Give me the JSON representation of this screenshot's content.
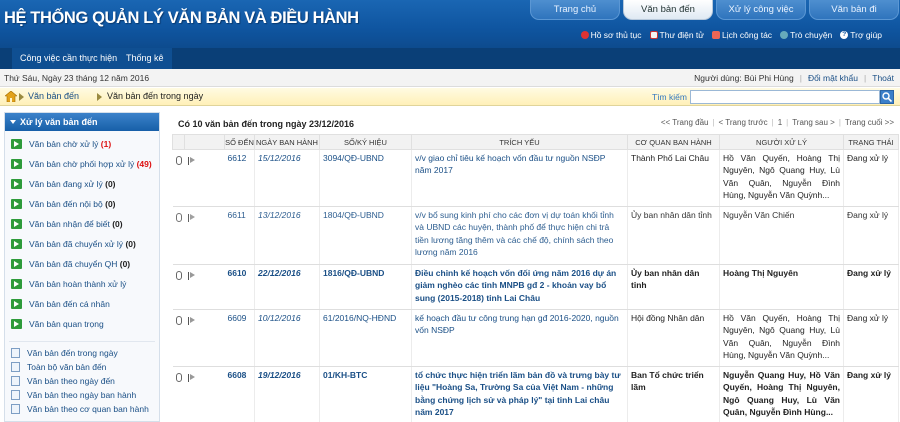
{
  "app": {
    "title": "HỆ THỐNG QUẢN LÝ VĂN BẢN VÀ ĐIỀU HÀNH"
  },
  "main_tabs": [
    {
      "label": "Trang chủ",
      "active": false
    },
    {
      "label": "Văn bản đến",
      "active": true
    },
    {
      "label": "Xử lý công việc",
      "active": false
    },
    {
      "label": "Văn bản đi",
      "active": false
    }
  ],
  "top_links": [
    {
      "label": "Hồ sơ thủ tục",
      "icon": "folder-icon"
    },
    {
      "label": "Thư điện tử",
      "icon": "mail-icon"
    },
    {
      "label": "Lịch công tác",
      "icon": "calendar-icon"
    },
    {
      "label": "Trò chuyện",
      "icon": "chat-icon"
    },
    {
      "label": "Trợ giúp",
      "icon": "help-icon"
    }
  ],
  "subnav": {
    "item1": "Công việc cần thực hiện",
    "item2": "Thống kê"
  },
  "infobar": {
    "date": "Thứ Sáu, Ngày 23 tháng 12 năm 2016",
    "user": "Người dùng: Bùi Phi Hùng",
    "change_password": "Đổi mật khẩu",
    "logout": "Thoát"
  },
  "breadcrumb": {
    "level1": "Văn bản đến",
    "level2": "Văn bản đến trong ngày"
  },
  "search": {
    "label": "Tìm kiếm",
    "value": "",
    "placeholder": ""
  },
  "sidebar": {
    "heading": "Xử lý văn bản đến",
    "items": [
      {
        "label": "Văn bản chờ xử lý",
        "count": "(1)",
        "red": true
      },
      {
        "label": "Văn bản chờ phối hợp xử lý",
        "count": "(49)",
        "red": true
      },
      {
        "label": "Văn bản đang xử lý",
        "count": "(0)",
        "red": false
      },
      {
        "label": "Văn bản đến nội bộ",
        "count": "(0)",
        "red": false
      },
      {
        "label": "Văn bản nhận để biết",
        "count": "(0)",
        "red": false
      },
      {
        "label": "Văn bản đã chuyển xử lý",
        "count": "(0)",
        "red": false
      },
      {
        "label": "Văn bản đã chuyển QH",
        "count": "(0)",
        "red": false
      },
      {
        "label": "Văn bản hoàn thành xử lý",
        "count": "",
        "red": false
      },
      {
        "label": "Văn bản đến cá nhân",
        "count": "",
        "red": false
      },
      {
        "label": "Văn bản quan trọng",
        "count": "",
        "red": false
      }
    ],
    "links": [
      "Văn bản đến trong ngày",
      "Toàn bộ văn bản đến",
      "Văn bản theo ngày đến",
      "Văn bản theo ngày ban hành",
      "Văn bản theo cơ quan ban hành"
    ]
  },
  "main": {
    "title": "Có 10 văn bản đến trong ngày 23/12/2016",
    "pager": {
      "first": "<< Trang đầu",
      "prev": "< Trang trước",
      "page": "1",
      "next": "Trang sau >",
      "last": "Trang cuối >>"
    },
    "columns": {
      "number": "SỐ ĐẾN",
      "issue_date": "NGÀY BAN HÀNH",
      "symbol": "SỐ/KÝ HIỆU",
      "summary": "TRÍCH YẾU",
      "org": "CƠ QUAN BAN HÀNH",
      "processor": "NGƯỜI XỬ LÝ",
      "status": "TRẠNG THÁI"
    },
    "rows": [
      {
        "number": "6612",
        "issue_date": "15/12/2016",
        "symbol": "3094/QĐ-UBND",
        "summary": "v/v giao chỉ tiêu kế hoạch vốn đầu tư nguồn NSĐP năm 2017",
        "org": "Thành Phố Lai Châu",
        "processor": "Hồ Văn Quyến, Hoàng Thị Nguyên, Ngô Quang Huy, Lù Văn Quân, Nguyễn Đình Hùng, Nguyễn Văn Quỳnh...",
        "status": "Đang xử lý",
        "bold": false
      },
      {
        "number": "6611",
        "issue_date": "13/12/2016",
        "symbol": "1804/QĐ-UBND",
        "summary": "v/v bổ sung kinh phí cho các đơn vị dự toán khối tỉnh và UBND các huyện, thành phố để thực hiện chi trả tiền lương tăng thêm và các chế độ, chính sách theo lương năm 2016",
        "org": "Ủy ban nhân dân tỉnh",
        "processor": "Nguyễn Văn Chiến",
        "status": "Đang xử lý",
        "bold": false
      },
      {
        "number": "6610",
        "issue_date": "22/12/2016",
        "symbol": "1816/QĐ-UBND",
        "summary": "Điều chỉnh kế hoạch vốn đối ứng năm 2016 dự án giảm nghèo các tỉnh MNPB gđ 2 - khoản vay bổ sung (2015-2018) tỉnh Lai Châu",
        "org": "Ủy ban nhân dân tỉnh",
        "processor": "Hoàng Thị Nguyên",
        "status": "Đang xử lý",
        "bold": true
      },
      {
        "number": "6609",
        "issue_date": "10/12/2016",
        "symbol": "61/2016/NQ-HĐND",
        "summary": "kế hoạch đầu tư công trung hạn gđ 2016-2020, nguồn vốn NSĐP",
        "org": "Hội đồng Nhân dân",
        "processor": "Hồ Văn Quyến, Hoàng Thị Nguyên, Ngô Quang Huy, Lù Văn Quân, Nguyễn Đình Hùng, Nguyễn Văn Quỳnh...",
        "status": "Đang xử lý",
        "bold": false
      },
      {
        "number": "6608",
        "issue_date": "19/12/2016",
        "symbol": "01/KH-BTC",
        "summary": "tổ chức thực hiện triển lãm bản đồ và trưng bày tư liệu \"Hoàng Sa, Trường Sa của Việt Nam - những bằng chứng lịch sử và pháp lý\" tại tỉnh Lai châu năm 2017",
        "org": "Ban Tổ chức triển lãm",
        "processor": "Nguyễn Quang Huy, Hồ Văn Quyến, Hoàng Thị Nguyên, Ngô Quang Huy, Lù Văn Quân, Nguyễn Đình Hùng...",
        "status": "Đang xử lý",
        "bold": true
      }
    ]
  }
}
